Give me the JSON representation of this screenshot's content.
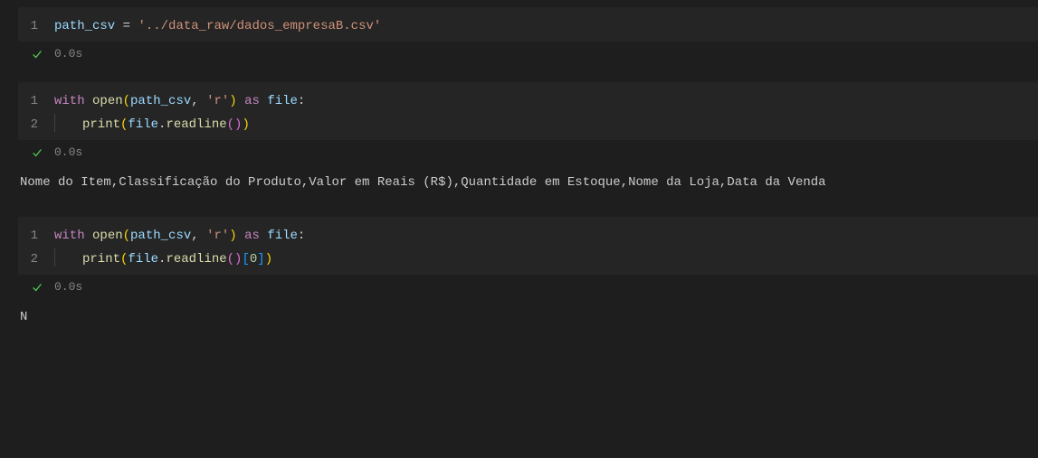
{
  "cells": [
    {
      "lines": [
        {
          "num": "1"
        }
      ],
      "code1": {
        "var": "path_csv",
        "eq": " = ",
        "str": "'../data_raw/dados_empresaB.csv'"
      },
      "status_time": "0.0s",
      "output": ""
    },
    {
      "lines": [
        {
          "num": "1"
        },
        {
          "num": "2"
        }
      ],
      "code2": {
        "with": "with",
        "open": "open",
        "lp": "(",
        "arg1": "path_csv",
        "comma": ", ",
        "mode": "'r'",
        "rp": ")",
        "as": "as",
        "file": "file",
        "colon": ":",
        "print": "print",
        "lp2": "(",
        "obj": "file",
        "dot": ".",
        "method": "readline",
        "call": "()",
        "rp2": ")"
      },
      "status_time": "0.0s",
      "output": "Nome do Item,Classificação do Produto,Valor em Reais (R$),Quantidade em Estoque,Nome da Loja,Data da Venda"
    },
    {
      "lines": [
        {
          "num": "1"
        },
        {
          "num": "2"
        }
      ],
      "code3": {
        "with": "with",
        "open": "open",
        "lp": "(",
        "arg1": "path_csv",
        "comma": ", ",
        "mode": "'r'",
        "rp": ")",
        "as": "as",
        "file": "file",
        "colon": ":",
        "print": "print",
        "lp2": "(",
        "obj": "file",
        "dot": ".",
        "method": "readline",
        "call": "()",
        "lbr": "[",
        "idx": "0",
        "rbr": "]",
        "rp2": ")"
      },
      "status_time": "0.0s",
      "output": "N"
    }
  ]
}
